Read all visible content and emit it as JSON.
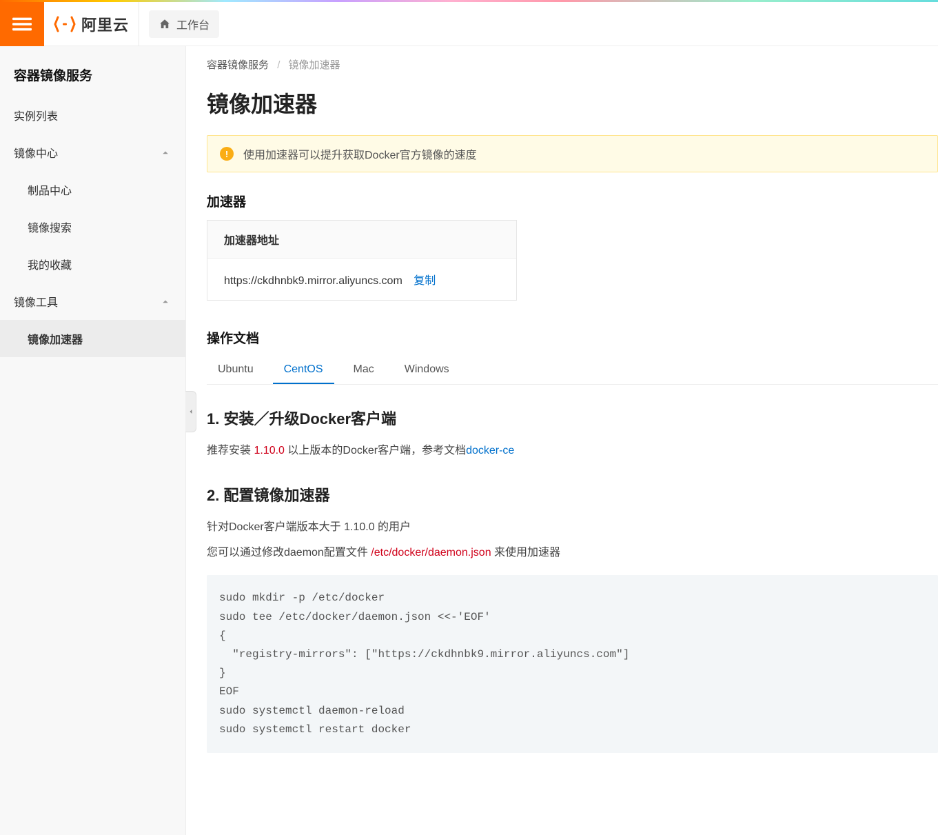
{
  "header": {
    "brand": "阿里云",
    "workspace": "工作台"
  },
  "sidebar": {
    "title": "容器镜像服务",
    "items": {
      "instances": "实例列表",
      "center": "镜像中心",
      "tools": "镜像工具"
    },
    "subs": {
      "artifact": "制品中心",
      "search": "镜像搜索",
      "favorites": "我的收藏",
      "accel": "镜像加速器"
    }
  },
  "breadcrumb": {
    "root": "容器镜像服务",
    "current": "镜像加速器"
  },
  "page": {
    "title": "镜像加速器",
    "banner": "使用加速器可以提升获取Docker官方镜像的速度"
  },
  "accel": {
    "section": "加速器",
    "addr_label": "加速器地址",
    "addr_value": "https://ckdhnbk9.mirror.aliyuncs.com",
    "copy": "复制"
  },
  "docs": {
    "section": "操作文档",
    "tabs": {
      "ubuntu": "Ubuntu",
      "centos": "CentOS",
      "mac": "Mac",
      "windows": "Windows"
    },
    "h1": "1. 安装／升级Docker客户端",
    "p1a": "推荐安装 ",
    "p1_ver": "1.10.0",
    "p1b": " 以上版本的Docker客户端，参考文档",
    "p1_link": "docker-ce",
    "h2": "2. 配置镜像加速器",
    "p2": "针对Docker客户端版本大于 1.10.0 的用户",
    "p3a": "您可以通过修改daemon配置文件 ",
    "p3_path": "/etc/docker/daemon.json",
    "p3b": " 来使用加速器",
    "code": "sudo mkdir -p /etc/docker\nsudo tee /etc/docker/daemon.json <<-'EOF'\n{\n  \"registry-mirrors\": [\"https://ckdhnbk9.mirror.aliyuncs.com\"]\n}\nEOF\nsudo systemctl daemon-reload\nsudo systemctl restart docker"
  }
}
